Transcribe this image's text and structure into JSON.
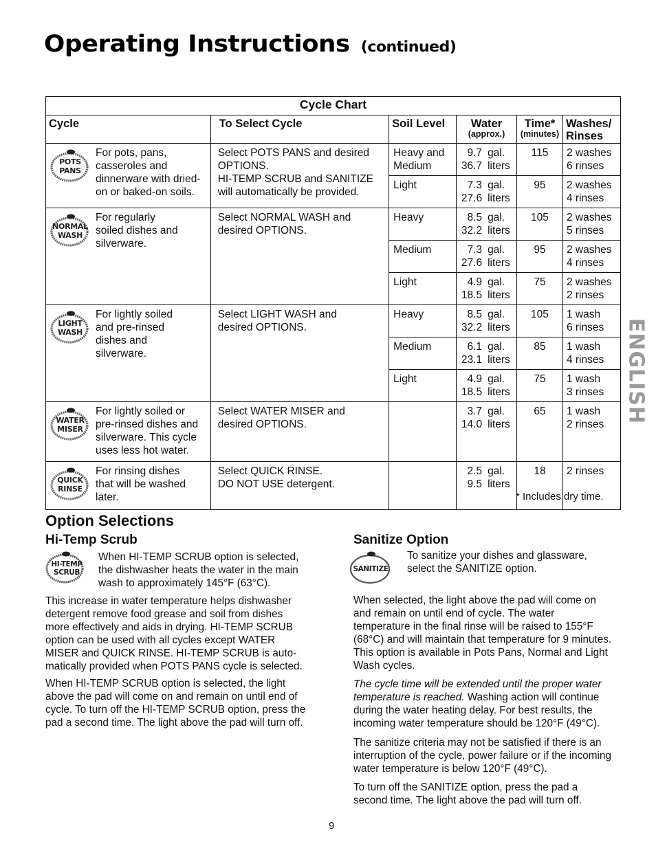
{
  "header": {
    "title": "Operating Instructions",
    "subtitle": "(continued)"
  },
  "cycle_chart": {
    "caption": "Cycle Chart",
    "columns": {
      "cycle": "Cycle",
      "select": "To Select Cycle",
      "soil": "Soil Level",
      "water": "Water",
      "water_sub": "(approx.)",
      "time": "Time*",
      "time_sub": "(minutes)",
      "washes": "Washes/ Rinses"
    },
    "cycles": [
      {
        "icon": [
          "POTS",
          "PANS"
        ],
        "description": "For pots, pans,\ncasseroles and\ndinnerware with dried-\non or baked-on soils.",
        "select": "Select POTS PANS and desired\nOPTIONS.\nHI-TEMP SCRUB and SANITIZE\nwill automatically be provided.",
        "levels": [
          {
            "soil": "Heavy and\nMedium",
            "gal": "9.7",
            "liters": "36.7",
            "time": "115",
            "washes": "2 washes\n6 rinses"
          },
          {
            "soil": "Light",
            "gal": "7.3",
            "liters": "27.6",
            "time": "95",
            "washes": "2 washes\n4 rinses"
          }
        ]
      },
      {
        "icon": [
          "NORMAL",
          "WASH"
        ],
        "description": "For regularly\nsoiled dishes and\nsilverware.",
        "select": "Select NORMAL WASH and\ndesired OPTIONS.",
        "levels": [
          {
            "soil": "Heavy",
            "gal": "8.5",
            "liters": "32.2",
            "time": "105",
            "washes": "2 washes\n5 rinses"
          },
          {
            "soil": "Medium",
            "gal": "7.3",
            "liters": "27.6",
            "time": "95",
            "washes": "2 washes\n4 rinses"
          },
          {
            "soil": "Light",
            "gal": "4.9",
            "liters": "18.5",
            "time": "75",
            "washes": "2 washes\n2 rinses"
          }
        ]
      },
      {
        "icon": [
          "LIGHT",
          "WASH"
        ],
        "description": "For lightly soiled\nand pre-rinsed\ndishes and\nsilverware.",
        "select": "Select LIGHT WASH and\ndesired OPTIONS.",
        "levels": [
          {
            "soil": "Heavy",
            "gal": "8.5",
            "liters": "32.2",
            "time": "105",
            "washes": "1 wash\n6 rinses"
          },
          {
            "soil": "Medium",
            "gal": "6.1",
            "liters": "23.1",
            "time": "85",
            "washes": "1 wash\n4 rinses"
          },
          {
            "soil": "Light",
            "gal": "4.9",
            "liters": "18.5",
            "time": "75",
            "washes": "1 wash\n3 rinses"
          }
        ]
      },
      {
        "icon": [
          "WATER",
          "MISER"
        ],
        "description": "For lightly soiled or\npre-rinsed dishes and\nsilverware. This cycle\nuses less hot water.",
        "select": "Select WATER MISER and\ndesired OPTIONS.",
        "levels": [
          {
            "soil": "",
            "gal": "3.7",
            "liters": "14.0",
            "time": "65",
            "washes": "1 wash\n2 rinses"
          }
        ]
      },
      {
        "icon": [
          "QUICK",
          "RINSE"
        ],
        "description": "For rinsing dishes\nthat will be washed\nlater.",
        "select": "Select QUICK RINSE.\nDO NOT USE detergent.",
        "levels": [
          {
            "soil": "",
            "gal": "2.5",
            "liters": "9.5",
            "time": "18",
            "washes": "2 rinses"
          }
        ]
      }
    ],
    "units": {
      "gal": "gal.",
      "liters": "liters"
    },
    "footnote": "* Includes dry time."
  },
  "options": {
    "title": "Option Selections",
    "hitemp": {
      "heading": "Hi-Temp Scrub",
      "icon": [
        "HI-TEMP",
        "SCRUB"
      ],
      "intro": "When HI-TEMP SCRUB option is selected,\nthe dishwasher heats the water in the main\nwash to approximately 145°F (63°C).",
      "p1": "This increase in water temperature helps dishwasher\ndetergent remove food grease and soil from dishes\nmore effectively and aids in drying. HI-TEMP SCRUB\noption can be used with all cycles except WATER\nMISER and QUICK RINSE. HI-TEMP SCRUB is auto-\nmatically provided when POTS PANS cycle is selected.",
      "p2": "When HI-TEMP SCRUB option is selected, the  light\nabove the pad will come on and remain on until end of\ncycle. To turn off the HI-TEMP SCRUB option, press the\npad a second time. The light above the pad will turn off."
    },
    "sanitize": {
      "heading": "Sanitize Option",
      "icon": [
        "SANITIZE"
      ],
      "intro": "To sanitize your dishes and glassware,\nselect the SANITIZE option.",
      "p1": "When selected, the light above the pad will come on\nand remain on until end of cycle. The water\ntemperature in the final rinse will be raised to 155°F\n(68°C) and will maintain that temperature for 9 minutes.\nThis option is available in Pots Pans, Normal and Light\nWash cycles.",
      "p2_italic": "The cycle time will be extended until the proper water\ntemperature is reached.",
      "p2_rest": " Washing action will continue\nduring the water heating delay. For best results, the\nincoming water temperature should be 120°F (49°C).",
      "p3": "The sanitize criteria may not be satisfied if there is an\ninterruption of the cycle, power failure or if the incoming\nwater temperature is below 120°F (49°C).",
      "p4": "To turn off the SANITIZE option, press the pad a\nsecond time. The light above the pad will turn off."
    }
  },
  "side_tab": "ENGLISH",
  "page_number": "9"
}
